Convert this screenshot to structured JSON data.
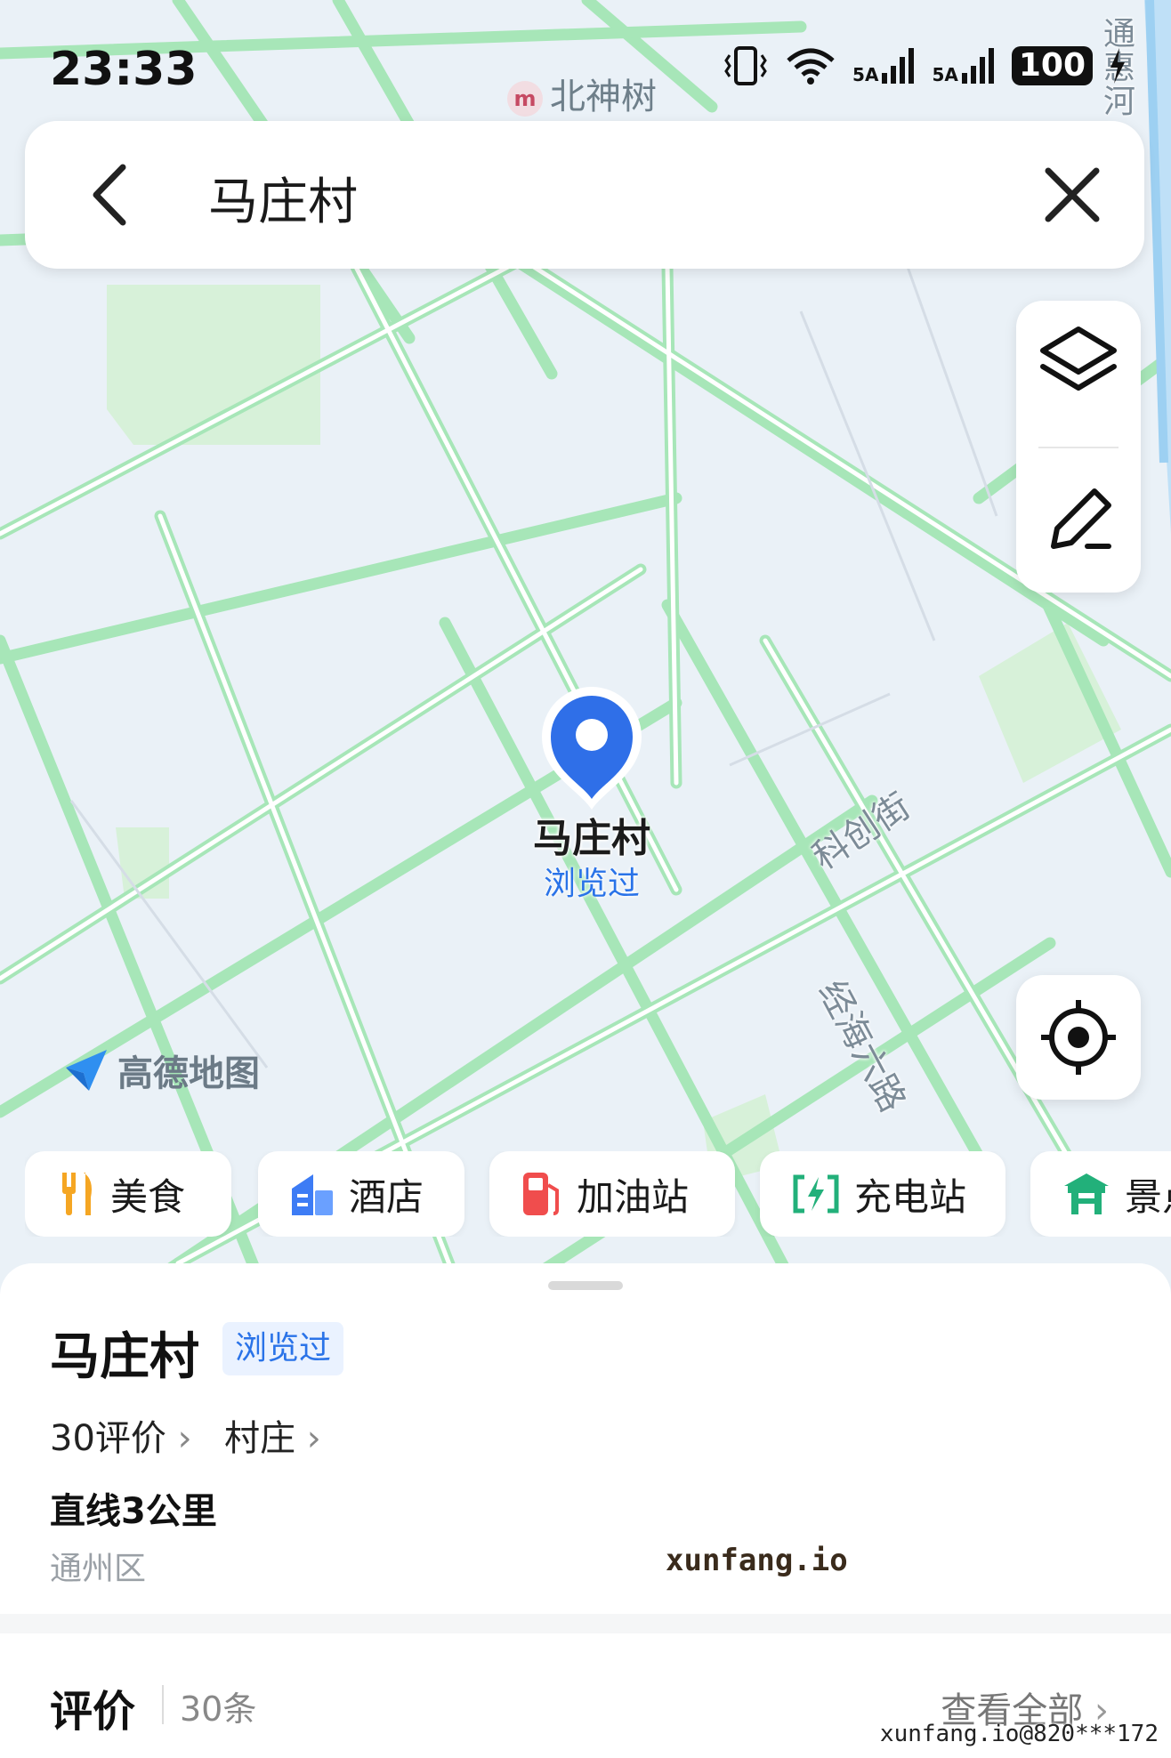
{
  "status_bar": {
    "time": "23:33",
    "signal_1": "5A",
    "signal_2": "5A",
    "battery": "100"
  },
  "map": {
    "poi_north": "北神树",
    "poi_north_icon": "metro-icon",
    "river_label": "通惠河",
    "road_labels": [
      "科创街",
      "经海六路"
    ],
    "logo_text": "高德地图",
    "pin_name": "马庄村",
    "pin_sub": "浏览过"
  },
  "search": {
    "query": "马庄村"
  },
  "categories": [
    {
      "label": "美食",
      "icon": "food-icon",
      "color": "#f5a623"
    },
    {
      "label": "酒店",
      "icon": "hotel-icon",
      "color": "#3d7cf5"
    },
    {
      "label": "加油站",
      "icon": "gas-station-icon",
      "color": "#f04d4d"
    },
    {
      "label": "充电站",
      "icon": "charging-station-icon",
      "color": "#22b07a"
    },
    {
      "label": "景点",
      "icon": "scenic-spot-icon",
      "color": "#22b07a"
    }
  ],
  "place": {
    "name": "马庄村",
    "badge": "浏览过",
    "reviews_link": "30评价",
    "category_link": "村庄",
    "distance": "直线3公里",
    "district": "通州区"
  },
  "watermarks": {
    "center": "xunfang.io",
    "corner": "xunfang.io@820***172"
  },
  "reviews": {
    "title": "评价",
    "count": "30条",
    "see_all": "查看全部"
  },
  "colors": {
    "accent": "#2a73e8",
    "road_green": "#a7e6b8"
  }
}
